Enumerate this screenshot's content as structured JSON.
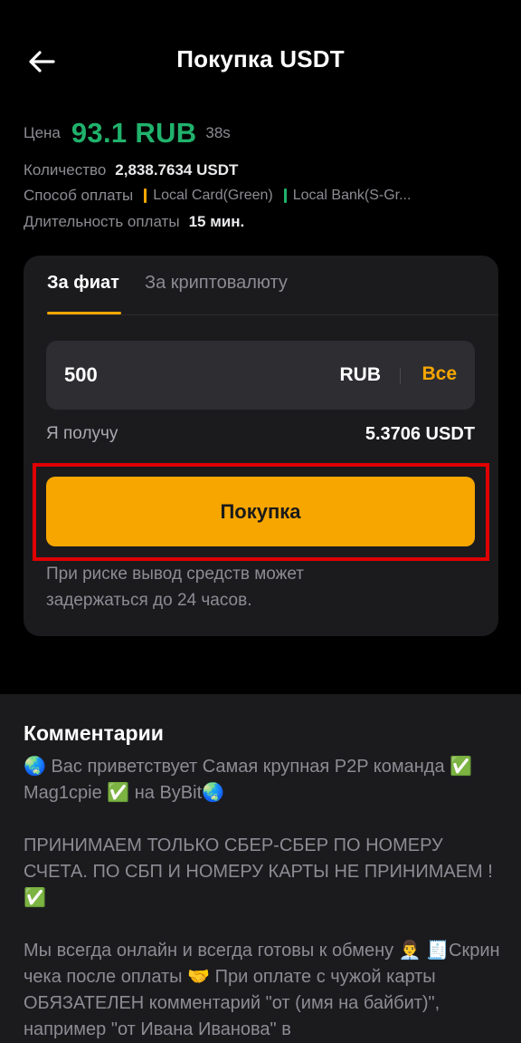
{
  "header": {
    "title": "Покупка USDT",
    "back_icon": "arrow-left-icon"
  },
  "info": {
    "price_label": "Цена",
    "price_value": "93.1 RUB",
    "price_timer": "38s",
    "quantity_label": "Количество",
    "quantity_value": "2,838.7634 USDT",
    "payment_label": "Способ оплаты",
    "payment_methods": [
      {
        "name": "Local Card(Green)",
        "color": "#f7a600"
      },
      {
        "name": "Local Bank(S-Gr...",
        "color": "#20b26c"
      }
    ],
    "duration_label": "Длительность оплаты",
    "duration_value": "15 мин."
  },
  "trade": {
    "tabs": [
      {
        "label": "За фиат",
        "active": true
      },
      {
        "label": "За криптовалюту",
        "active": false
      }
    ],
    "amount_value": "500",
    "currency": "RUB",
    "all_label": "Все",
    "receive_label": "Я получу",
    "receive_value": "5.3706 USDT",
    "buy_label": "Покупка",
    "risk_note": "При риске вывод средств может задержаться до 24 часов."
  },
  "comments": {
    "title": "Комментарии",
    "paragraphs": [
      "🌏 Вас приветствует Самая крупная P2P команда ✅ Mag1cpie ✅ на ByBit🌏",
      "ПРИНИМАЕМ ТОЛЬКО СБЕР-СБЕР ПО НОМЕРУ СЧЕТА. ПО СБП И НОМЕРУ КАРТЫ НЕ ПРИНИМАЕМ ! ✅",
      "Мы всегда онлайн и всегда готовы к обмену 👨‍💼 🧾Скрин чека после оплаты 🤝 При оплате с чужой карты ОБЯЗАТЕЛЕН комментарий \"от (имя на байбит)\", например \"от Ивана Иванова\" в"
    ]
  },
  "colors": {
    "accent": "#f7a600",
    "price_green": "#20b26c",
    "highlight_red": "#e00000"
  }
}
